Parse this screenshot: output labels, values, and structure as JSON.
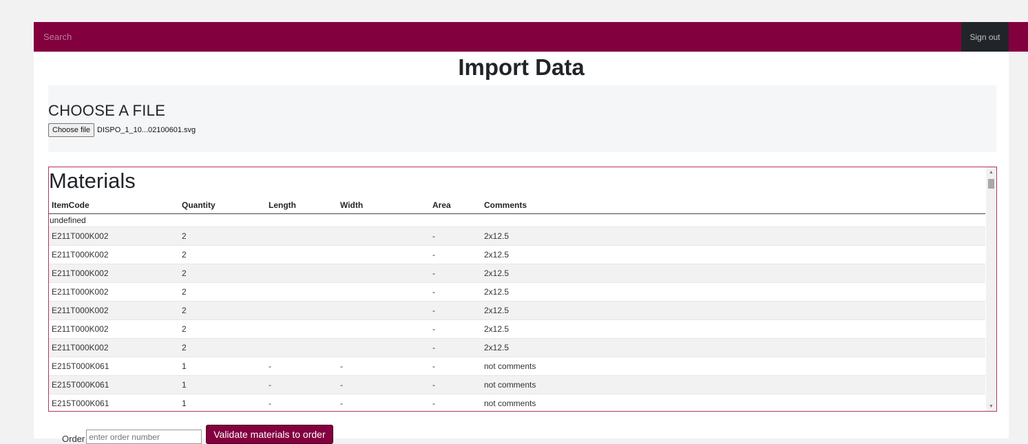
{
  "topbar": {
    "search_placeholder": "Search",
    "signout_label": "Sign out",
    "brand_color": "#82003e"
  },
  "page_title": "Import Data",
  "file_section": {
    "heading": "CHOOSE A FILE",
    "choose_button": "Choose file",
    "file_name": "DISPO_1_10...02100601.svg"
  },
  "materials": {
    "title": "Materials",
    "columns": [
      "ItemCode",
      "Quantity",
      "Length",
      "Width",
      "Area",
      "Comments"
    ],
    "group_label": "undefined",
    "rows": [
      [
        "E211T000K002",
        "2",
        "",
        "",
        "-",
        "2x12.5"
      ],
      [
        "E211T000K002",
        "2",
        "",
        "",
        "-",
        "2x12.5"
      ],
      [
        "E211T000K002",
        "2",
        "",
        "",
        "-",
        "2x12.5"
      ],
      [
        "E211T000K002",
        "2",
        "",
        "",
        "-",
        "2x12.5"
      ],
      [
        "E211T000K002",
        "2",
        "",
        "",
        "-",
        "2x12.5"
      ],
      [
        "E211T000K002",
        "2",
        "",
        "",
        "-",
        "2x12.5"
      ],
      [
        "E211T000K002",
        "2",
        "",
        "",
        "-",
        "2x12.5"
      ],
      [
        "E215T000K061",
        "1",
        "-",
        "-",
        "-",
        "not comments"
      ],
      [
        "E215T000K061",
        "1",
        "-",
        "-",
        "-",
        "not comments"
      ],
      [
        "E215T000K061",
        "1",
        "-",
        "-",
        "-",
        "not comments"
      ]
    ]
  },
  "order": {
    "label": "Order",
    "placeholder": "enter order number",
    "validate_button": "Validate materials to order"
  },
  "scrollbar": {
    "up_icon": "▲",
    "down_icon": "▼"
  }
}
